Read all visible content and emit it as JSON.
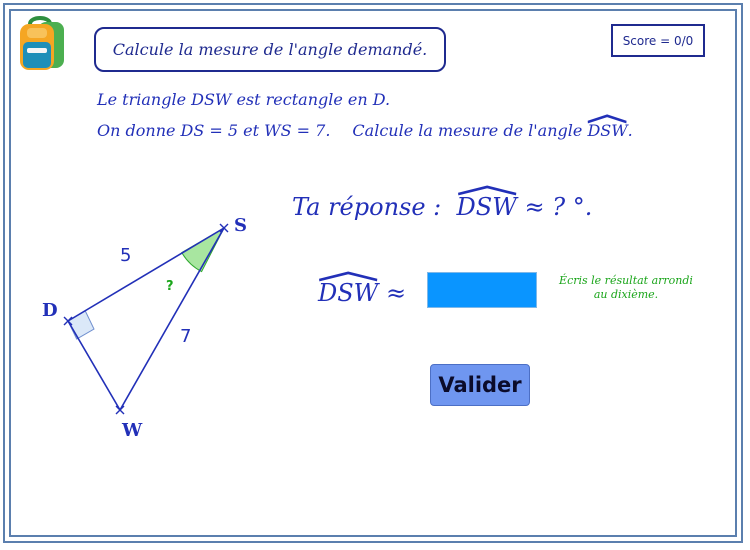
{
  "instruction": "Calcule la mesure de l'angle demandé.",
  "score": "Score = 0/0",
  "statement": {
    "line1": "Le triangle DSW est rectangle en D.",
    "line2_given": "On donne DS = 5 et WS = 7.",
    "line2_task_prefix": "Calcule la mesure de l'angle",
    "line2_angle": "DSW",
    "line2_suffix": "."
  },
  "figure": {
    "vertex_d": "D",
    "vertex_s": "S",
    "vertex_w": "W",
    "side_ds": "5",
    "side_ws": "7",
    "angle_mark": "?"
  },
  "answer": {
    "title_prefix": "Ta réponse :",
    "title_angle": "DSW",
    "title_suffix": "≈ ? °.",
    "row_angle": "DSW",
    "row_approx": "≈",
    "input_value": "",
    "hint": "Écris le résultat arrondi au dixième."
  },
  "validate_label": "Valider",
  "colors": {
    "text_blue": "#2230b8",
    "frame": "#5b7fae",
    "input_bg": "#0a95ff",
    "button_bg": "#6f96f0",
    "hint_green": "#1aa51a",
    "angle_fill": "#a8e6a0"
  }
}
